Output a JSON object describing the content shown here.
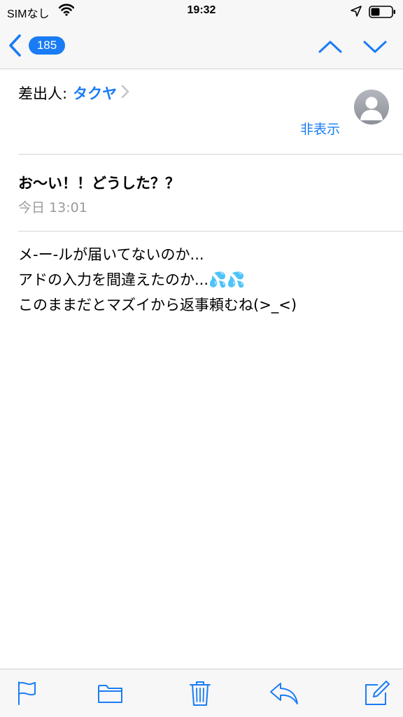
{
  "status_bar": {
    "carrier": "SIMなし",
    "time": "19:32"
  },
  "nav": {
    "back_count": "185"
  },
  "message": {
    "sender_label": "差出人:",
    "sender_name": "タクヤ",
    "hide_label": "非表示",
    "subject": "お〜い！！どうした？？",
    "date": "今日 13:01",
    "body_lines": [
      "メ-ー-ルが届いてないのか...",
      "アドの入力を間違えたのか...💦💦",
      "このままだとマズイから返事頼むね(>_<)"
    ]
  },
  "icons": {
    "wifi": "wifi-icon",
    "location": "location-arrow-icon",
    "battery": "battery-icon",
    "back": "chevron-left-icon",
    "up": "chevron-up-icon",
    "down": "chevron-down-icon",
    "sender_chevron": "chevron-right-icon",
    "avatar": "person-icon",
    "flag": "flag-icon",
    "folder": "folder-icon",
    "trash": "trash-icon",
    "reply": "reply-icon",
    "compose": "compose-icon"
  },
  "colors": {
    "accent": "#1a7cf5",
    "secondary_text": "#9a9a9a",
    "bar_background": "#f7f7f7"
  }
}
